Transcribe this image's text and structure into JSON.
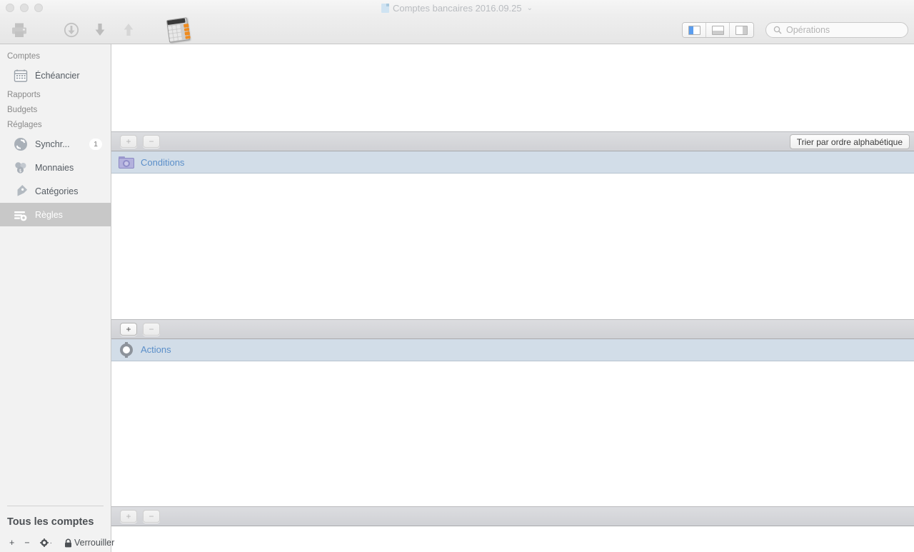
{
  "window": {
    "title": "Comptes bancaires 2016.09.25",
    "title_icon": "document-icon",
    "chevron": "⌄",
    "traffic_lights": [
      "close",
      "minimize",
      "zoom"
    ]
  },
  "toolbar": {
    "buttons": [
      {
        "name": "print-icon",
        "label": "Imprimer"
      },
      {
        "name": "download-circle-icon",
        "label": "Télécharger"
      },
      {
        "name": "import-down-arrow-icon",
        "label": "Importer"
      },
      {
        "name": "export-up-arrow-icon",
        "label": "Exporter"
      },
      {
        "name": "calculator-icon",
        "label": "Calculatrice"
      }
    ],
    "view_modes": [
      {
        "name": "view-sidebar-left",
        "active": true
      },
      {
        "name": "view-panel-bottom",
        "active": false
      },
      {
        "name": "view-panel-right",
        "active": false
      }
    ],
    "search": {
      "placeholder": "Opérations",
      "value": "",
      "icon": "search-icon"
    }
  },
  "sidebar": {
    "sections": [
      {
        "header": "Comptes",
        "items": [
          {
            "label": "Échéancier",
            "icon": "calendar-icon",
            "selected": false,
            "badge": ""
          }
        ]
      },
      {
        "header": "Rapports",
        "items": []
      },
      {
        "header": "Budgets",
        "items": []
      },
      {
        "header": "Réglages",
        "items": [
          {
            "label": "Synchr...",
            "icon": "sync-icon",
            "selected": false,
            "badge": "1"
          },
          {
            "label": "Monnaies",
            "icon": "coins-icon",
            "selected": false,
            "badge": ""
          },
          {
            "label": "Catégories",
            "icon": "tag-icon",
            "selected": false,
            "badge": ""
          },
          {
            "label": "Règles",
            "icon": "rules-icon",
            "selected": true,
            "badge": ""
          }
        ]
      }
    ],
    "footer": {
      "title": "Tous les comptes",
      "actions": [
        {
          "name": "add-account-button",
          "label": "+"
        },
        {
          "name": "remove-account-button",
          "label": "−"
        },
        {
          "name": "account-settings-button",
          "label": "⚙",
          "suffix": "·"
        },
        {
          "name": "lock-button",
          "label": "Verrouiller",
          "icon": "lock-icon"
        }
      ]
    }
  },
  "main": {
    "conditions_bar": {
      "add_label": "+",
      "remove_label": "−",
      "sort_label": "Trier par ordre alphabétique"
    },
    "conditions_row": {
      "label": "Conditions",
      "icon": "folder-gear-icon",
      "selected": true
    },
    "actions_bar": {
      "add_label": "+",
      "remove_label": "−"
    },
    "actions_row": {
      "label": "Actions",
      "icon": "gear-icon",
      "selected": true
    },
    "bottom_bar": {
      "add_label": "+",
      "remove_label": "−"
    }
  },
  "colors": {
    "selection_row": "#d2dde8",
    "row_text": "#5b8fc9",
    "sidebar_selected": "#c8c8c8",
    "accent_blue": "#5b9dee",
    "bar_gray": "#d4d5d9"
  }
}
